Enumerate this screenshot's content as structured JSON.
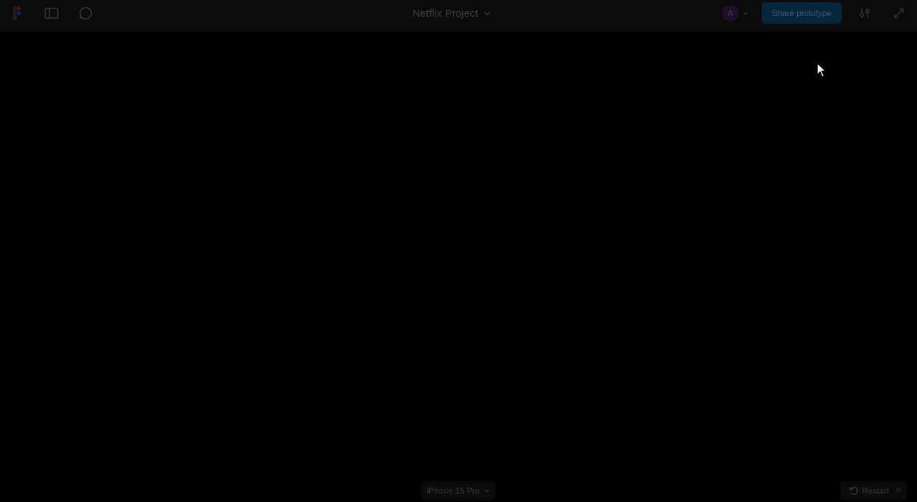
{
  "header": {
    "project_title": "Netflix Project",
    "avatar_initial": "A",
    "share_label": "Share prototype"
  },
  "footer": {
    "device_label": "iPhone 15 Pro",
    "restart_label": "Restart",
    "restart_shortcut": "R"
  },
  "icons": {
    "logo": "figma-logo-icon",
    "sidebar": "sidebar-panel-icon",
    "comment": "comment-bubble-icon",
    "title_chevron": "chevron-down-icon",
    "avatar_chevron": "chevron-down-icon",
    "settings": "settings-sliders-icon",
    "expand": "expand-icon",
    "device_chevron": "chevron-down-icon",
    "restart": "restart-arrow-icon",
    "cursor": "mouse-pointer-icon"
  },
  "colors": {
    "background": "#000000",
    "topbar": "#0b0b0b",
    "share_button": "#06263b"
  }
}
